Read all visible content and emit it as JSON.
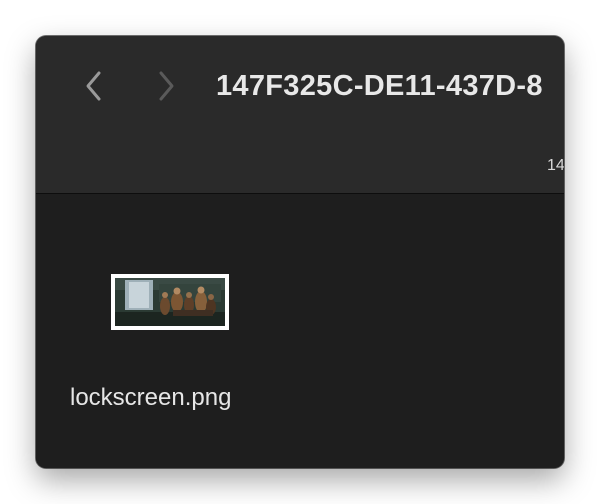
{
  "window": {
    "title": "147F325C-DE11-437D-8",
    "path_label": "14"
  },
  "toolbar": {
    "back_icon": "chevron-left-icon",
    "forward_icon": "chevron-right-icon"
  },
  "files": [
    {
      "name": "lockscreen.png",
      "thumbnail_icon": "image-thumbnail"
    }
  ],
  "colors": {
    "toolbar_bg": "#2a2a2a",
    "content_bg": "#1e1e1e",
    "text": "#e6e6e6",
    "icon_active": "#9a9a9a",
    "icon_disabled": "#5a5a5a"
  }
}
